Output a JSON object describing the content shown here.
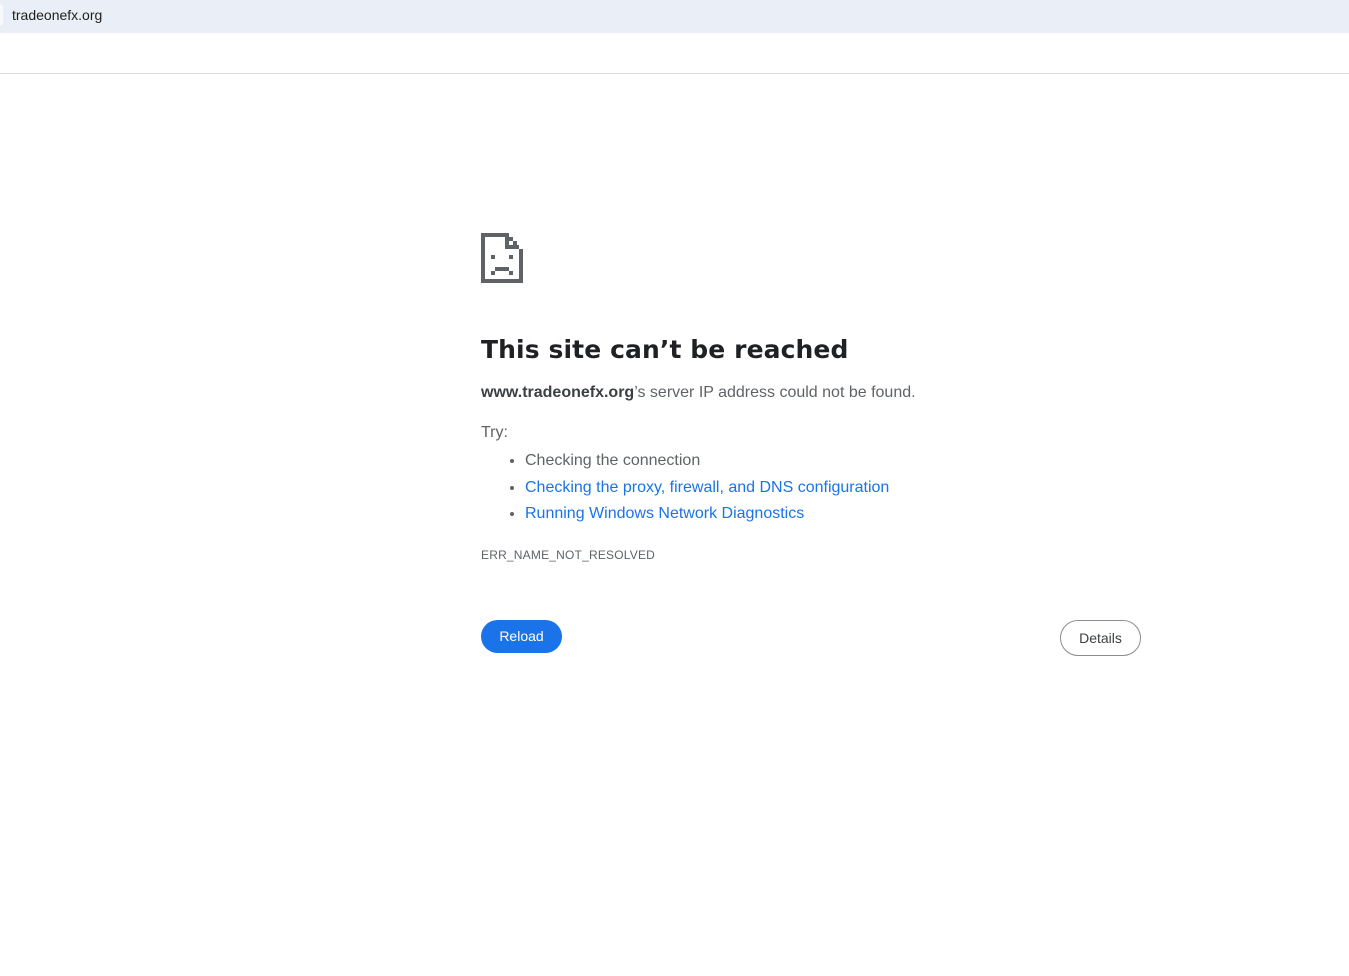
{
  "tab": {
    "url_text": "tradeonefx.org"
  },
  "error": {
    "icon": "sad-page-icon",
    "title": "This site can’t be reached",
    "host": "www.tradeonefx.org",
    "description_suffix": "’s server IP address could not be found.",
    "try_label": "Try:",
    "suggestions": [
      {
        "label": "Checking the connection",
        "is_link": false
      },
      {
        "label": "Checking the proxy, firewall, and DNS configuration",
        "is_link": true
      },
      {
        "label": "Running Windows Network Diagnostics",
        "is_link": true
      }
    ],
    "code": "ERR_NAME_NOT_RESOLVED"
  },
  "buttons": {
    "reload_label": "Reload",
    "details_label": "Details"
  },
  "colors": {
    "accent": "#1a73e8",
    "tabbar_bg": "#e9eef7",
    "text_secondary": "#5f6368",
    "text_primary": "#202124"
  }
}
